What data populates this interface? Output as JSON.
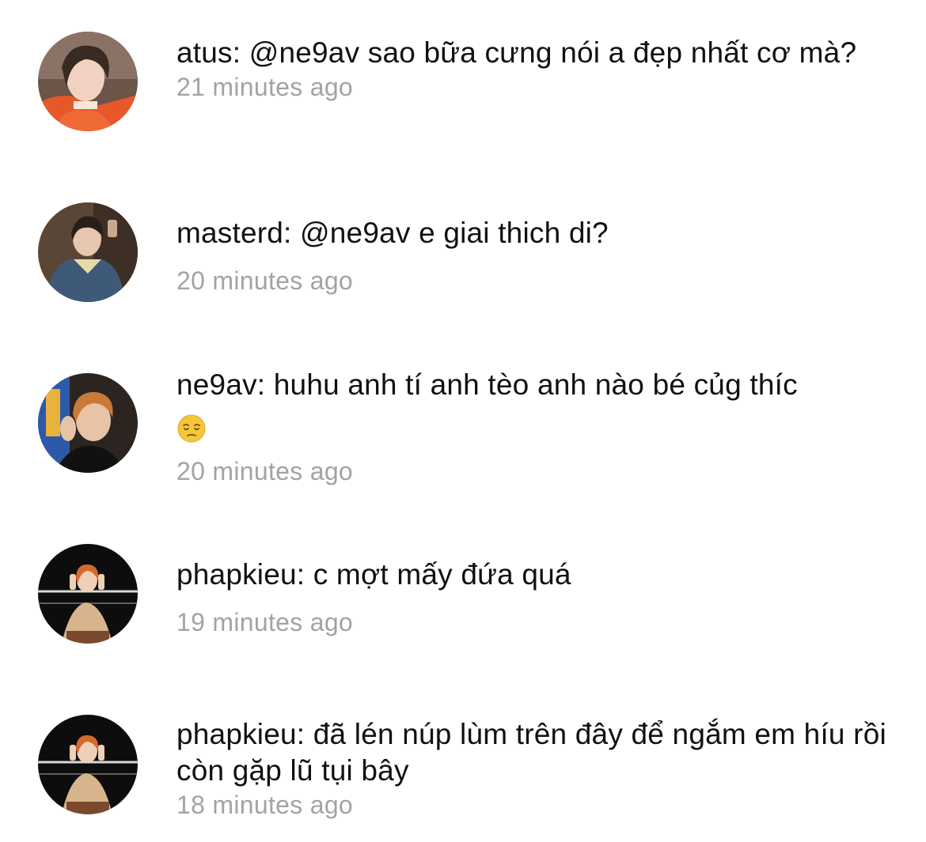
{
  "comments": [
    {
      "text": "atus: @ne9av sao bữa cưng nói a đẹp nhất cơ mà?",
      "time": "21 minutes ago",
      "avatar": "avatar-atus"
    },
    {
      "text": "masterd: @ne9av e giai thich di?",
      "time": "20 minutes ago",
      "avatar": "avatar-masterd"
    },
    {
      "text": "ne9av: huhu anh tí anh tèo anh nào bé củg thíc",
      "emoji": "pensive-face-emoji",
      "time": "20 minutes ago",
      "avatar": "avatar-ne9av"
    },
    {
      "text": "phapkieu: c mợt mấy đứa quá",
      "time": "19 minutes ago",
      "avatar": "avatar-phapkieu"
    },
    {
      "text": "phapkieu: đã lén núp lùm trên đây để ngắm em híu rồi còn gặp lũ tụi bây",
      "time": "18 minutes ago",
      "avatar": "avatar-phapkieu"
    }
  ],
  "colors": {
    "text": "#111111",
    "timestamp": "#a3a3a3",
    "background": "#ffffff"
  }
}
